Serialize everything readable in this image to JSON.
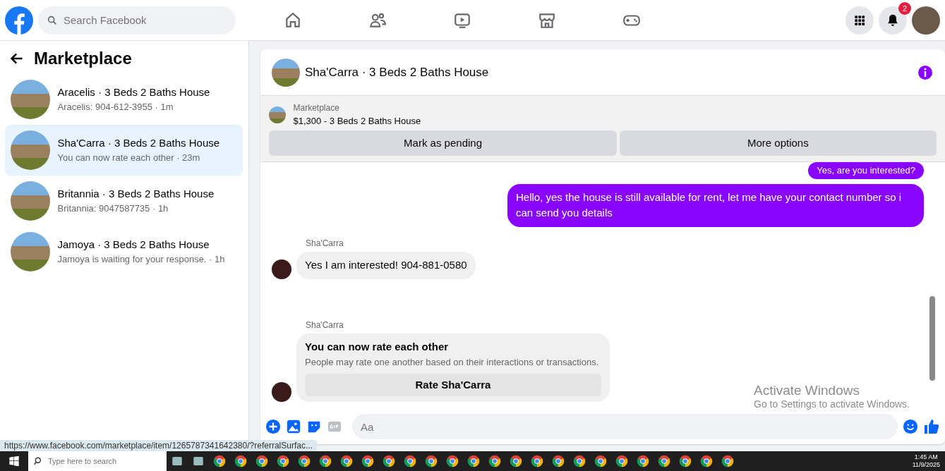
{
  "topbar": {
    "search": {
      "placeholder": "Search Facebook"
    },
    "nav": [
      {
        "kind": "home",
        "selected": false
      },
      {
        "kind": "friends",
        "selected": false
      },
      {
        "kind": "video",
        "selected": false
      },
      {
        "kind": "store",
        "selected": false
      },
      {
        "kind": "gaming",
        "selected": false
      }
    ],
    "notification_count": "2"
  },
  "sidebar": {
    "title": "Marketplace",
    "items": [
      {
        "title": "Aracelis · 3 Beds 2 Baths House",
        "subtitle": "Aracelis: 904-612-3955 · 1m",
        "selected": false
      },
      {
        "title": "Sha'Carra · 3 Beds 2 Baths House",
        "subtitle": "You can now rate each other · 23m",
        "selected": true
      },
      {
        "title": "Britannia · 3 Beds 2 Baths House",
        "subtitle": "Britannia: 9047587735 · 1h",
        "selected": false
      },
      {
        "title": "Jamoya · 3 Beds 2 Baths House",
        "subtitle": "Jamoya is waiting for your response. · 1h",
        "selected": false
      }
    ]
  },
  "chat": {
    "title": "Sha'Carra · 3 Beds 2 Baths House",
    "listing": {
      "label": "Marketplace",
      "name": "$1,300 - 3 Beds 2 Baths House"
    },
    "buttons": [
      "Mark as pending",
      "More options"
    ],
    "messages": [
      {
        "kind": "sent",
        "text": "Yes, are you interested?"
      },
      {
        "kind": "sent",
        "text": "Hello, yes the house is still available for rent, let me have your contact number so i can send you  details"
      },
      {
        "kind": "received",
        "sender": "Sha'Carra",
        "text": "Yes I am interested! 904-881-0580"
      },
      {
        "kind": "rating",
        "sender": "Sha'Carra",
        "title": "You can now rate each other",
        "text": "People may rate one another based on their interactions or transactions.",
        "button": "Rate Sha'Carra"
      }
    ],
    "composer": {
      "placeholder": "Aa"
    }
  },
  "activation_notice": {
    "title": "Activate Windows",
    "text": "Go to Settings to activate Windows."
  },
  "link_preview": "https://www.facebook.com/marketplace/item/1265787341642380/?referralSurfac...",
  "taskbar": {
    "search": {
      "placeholder": "Type here to search"
    },
    "apps": [
      {
        "kind": "app"
      },
      {
        "kind": "app"
      },
      {
        "kind": "browser"
      },
      {
        "kind": "browser"
      },
      {
        "kind": "browser"
      },
      {
        "kind": "browser"
      },
      {
        "kind": "browser"
      },
      {
        "kind": "browser"
      },
      {
        "kind": "browser"
      },
      {
        "kind": "browser"
      },
      {
        "kind": "browser"
      },
      {
        "kind": "browser"
      },
      {
        "kind": "browser"
      },
      {
        "kind": "browser"
      },
      {
        "kind": "browser"
      },
      {
        "kind": "browser"
      },
      {
        "kind": "browser"
      },
      {
        "kind": "browser"
      },
      {
        "kind": "browser"
      },
      {
        "kind": "browser"
      },
      {
        "kind": "browser"
      },
      {
        "kind": "browser"
      },
      {
        "kind": "browser"
      },
      {
        "kind": "browser"
      },
      {
        "kind": "browser"
      },
      {
        "kind": "browser"
      },
      {
        "kind": "browser"
      }
    ],
    "time": "1:45 AM",
    "date": "11/9/2025"
  }
}
